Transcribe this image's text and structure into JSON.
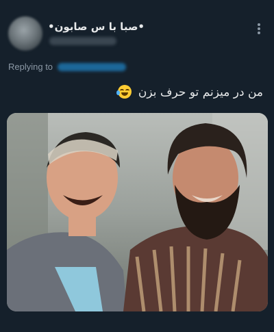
{
  "post": {
    "author_name": "•صبا با س صابون•",
    "more_icon": "more-vertical-icon",
    "replying_label": "Replying to",
    "text": "من در میزنم تو حرف بزن",
    "emoji": "face-with-tears-of-joy-icon"
  },
  "colors": {
    "background": "#15202b",
    "primary_text": "#e7e9ea",
    "secondary_text": "#8b98a5",
    "link": "#1d9bf0"
  }
}
